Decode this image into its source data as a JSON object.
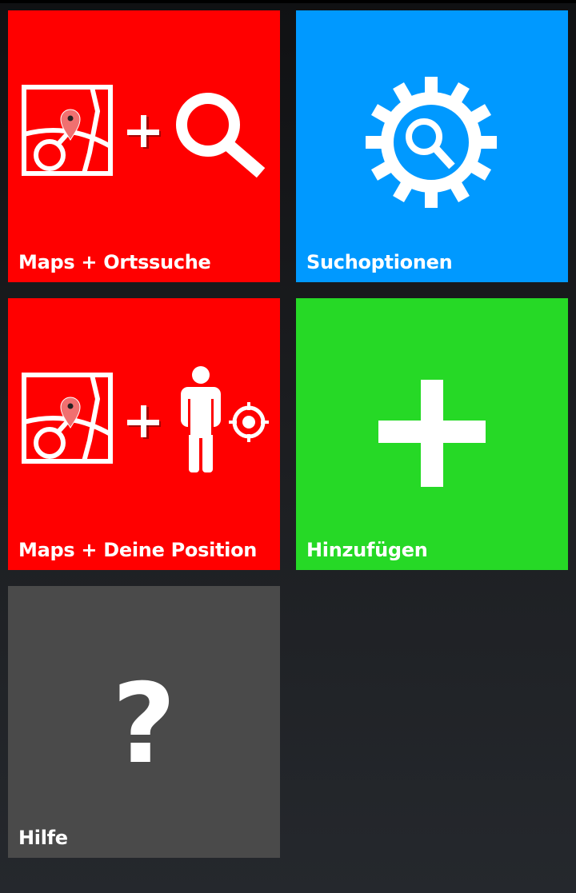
{
  "tiles": [
    {
      "id": "maps-search",
      "label": "Maps + Ortssuche",
      "color": "#ff0000",
      "icon": "map-plus-search-icon"
    },
    {
      "id": "search-options",
      "label": "Suchoptionen",
      "color": "#0099ff",
      "icon": "gear-search-icon"
    },
    {
      "id": "maps-position",
      "label": "Maps + Deine Position",
      "color": "#ff0000",
      "icon": "map-plus-position-icon"
    },
    {
      "id": "add",
      "label": "Hinzufügen",
      "color": "#26d926",
      "icon": "plus-icon"
    },
    {
      "id": "help",
      "label": "Hilfe",
      "color": "#4a4a4a",
      "icon": "question-mark-icon"
    }
  ],
  "help_glyph": "?"
}
